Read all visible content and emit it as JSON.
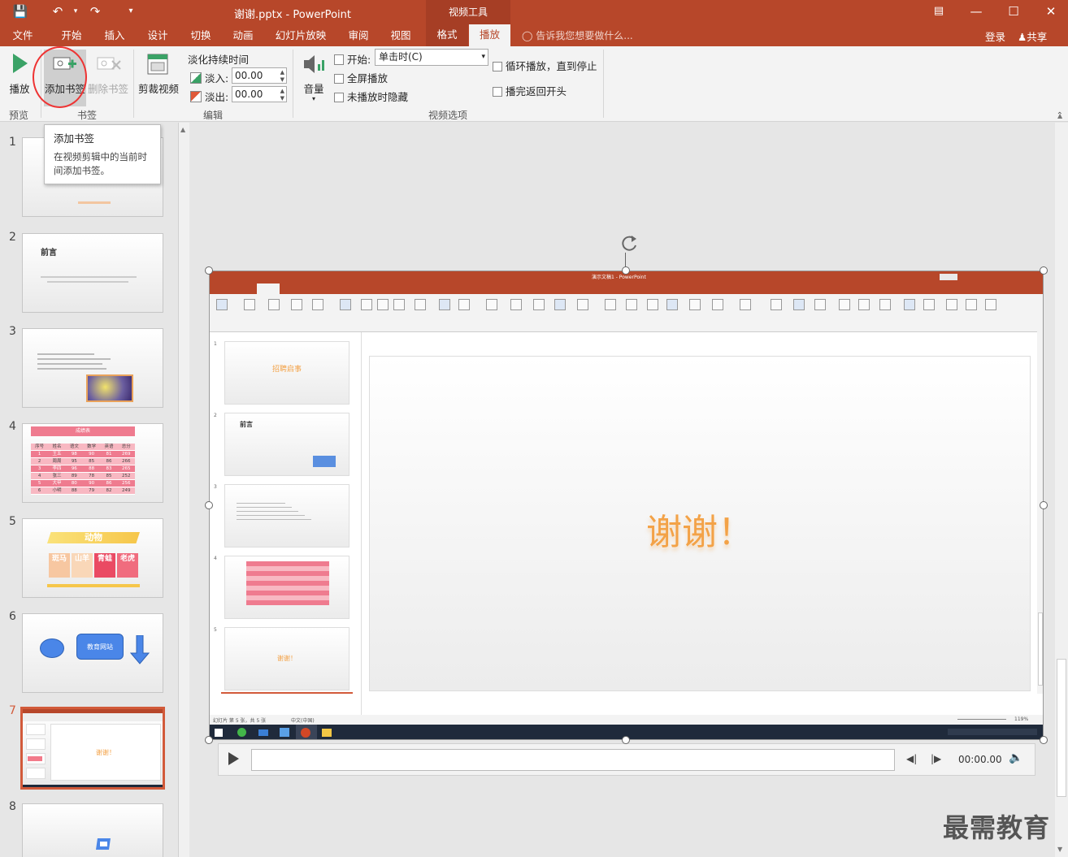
{
  "app": {
    "title": "谢谢.pptx - PowerPoint",
    "tools_group": "视频工具",
    "login": "登录",
    "share": "共享",
    "tell_me": "告诉我您想要做什么..."
  },
  "tabs": [
    {
      "label": "文件"
    },
    {
      "label": "开始"
    },
    {
      "label": "插入"
    },
    {
      "label": "设计"
    },
    {
      "label": "切换"
    },
    {
      "label": "动画"
    },
    {
      "label": "幻灯片放映"
    },
    {
      "label": "审阅"
    },
    {
      "label": "视图"
    },
    {
      "label": "格式"
    },
    {
      "label": "播放"
    }
  ],
  "ribbon": {
    "preview": {
      "play": "播放",
      "group": "预览"
    },
    "bookmarks": {
      "add": "添加书签",
      "remove": "删除书签",
      "group": "书签"
    },
    "editing": {
      "trim": "剪裁视频",
      "fade_title": "淡化持续时间",
      "fade_in_label": "淡入:",
      "fade_in_value": "00.00",
      "fade_out_label": "淡出:",
      "fade_out_value": "00.00",
      "group": "编辑"
    },
    "video_options": {
      "volume": "音量",
      "start_label": "开始:",
      "start_value": "单击时(C)",
      "fullscreen": "全屏播放",
      "hide": "未播放时隐藏",
      "loop": "循环播放，直到停止",
      "rewind": "播完返回开头",
      "group": "视频选项"
    }
  },
  "tooltip": {
    "title": "添加书签",
    "desc_line1": "在视频剪辑中的当前时",
    "desc_line2": "间添加书签。"
  },
  "thumbnails": [
    {
      "num": "1"
    },
    {
      "num": "2",
      "title": "前言"
    },
    {
      "num": "3"
    },
    {
      "num": "4",
      "title": "成绩表"
    },
    {
      "num": "5",
      "title": "动物"
    },
    {
      "num": "6",
      "title": "教育网站"
    },
    {
      "num": "7",
      "title": "谢谢！"
    },
    {
      "num": "8"
    }
  ],
  "slide5_tiles": [
    "斑马",
    "山羊",
    "青蛙",
    "老虎"
  ],
  "table4": {
    "headers": [
      "序号",
      "姓名",
      "语文",
      "数学",
      "英语",
      "总分"
    ],
    "rows": [
      [
        "1",
        "王五",
        "98",
        "90",
        "81",
        "269"
      ],
      [
        "2",
        "周周",
        "95",
        "85",
        "86",
        "266"
      ],
      [
        "3",
        "李四",
        "96",
        "88",
        "83",
        "265"
      ],
      [
        "4",
        "张三",
        "89",
        "78",
        "85",
        "252"
      ],
      [
        "5",
        "大甲",
        "80",
        "90",
        "86",
        "256"
      ],
      [
        "6",
        "小明",
        "88",
        "79",
        "82",
        "249"
      ]
    ]
  },
  "video": {
    "inner_title": "演示文稿1 - PowerPoint",
    "inner_thumbs": [
      "1",
      "2",
      "3",
      "4",
      "5"
    ],
    "inner_thumb1_title": "招聘启事",
    "inner_thumb2_title": "前言",
    "inner_thumb5_text": "谢谢！",
    "main_text": "谢谢！",
    "status_left": "幻灯片 第 5 张，共 5 张",
    "status_lang": "中文(中国)",
    "zoom": "119%"
  },
  "playbar": {
    "time": "00:00.00"
  },
  "watermark": "最需教育"
}
